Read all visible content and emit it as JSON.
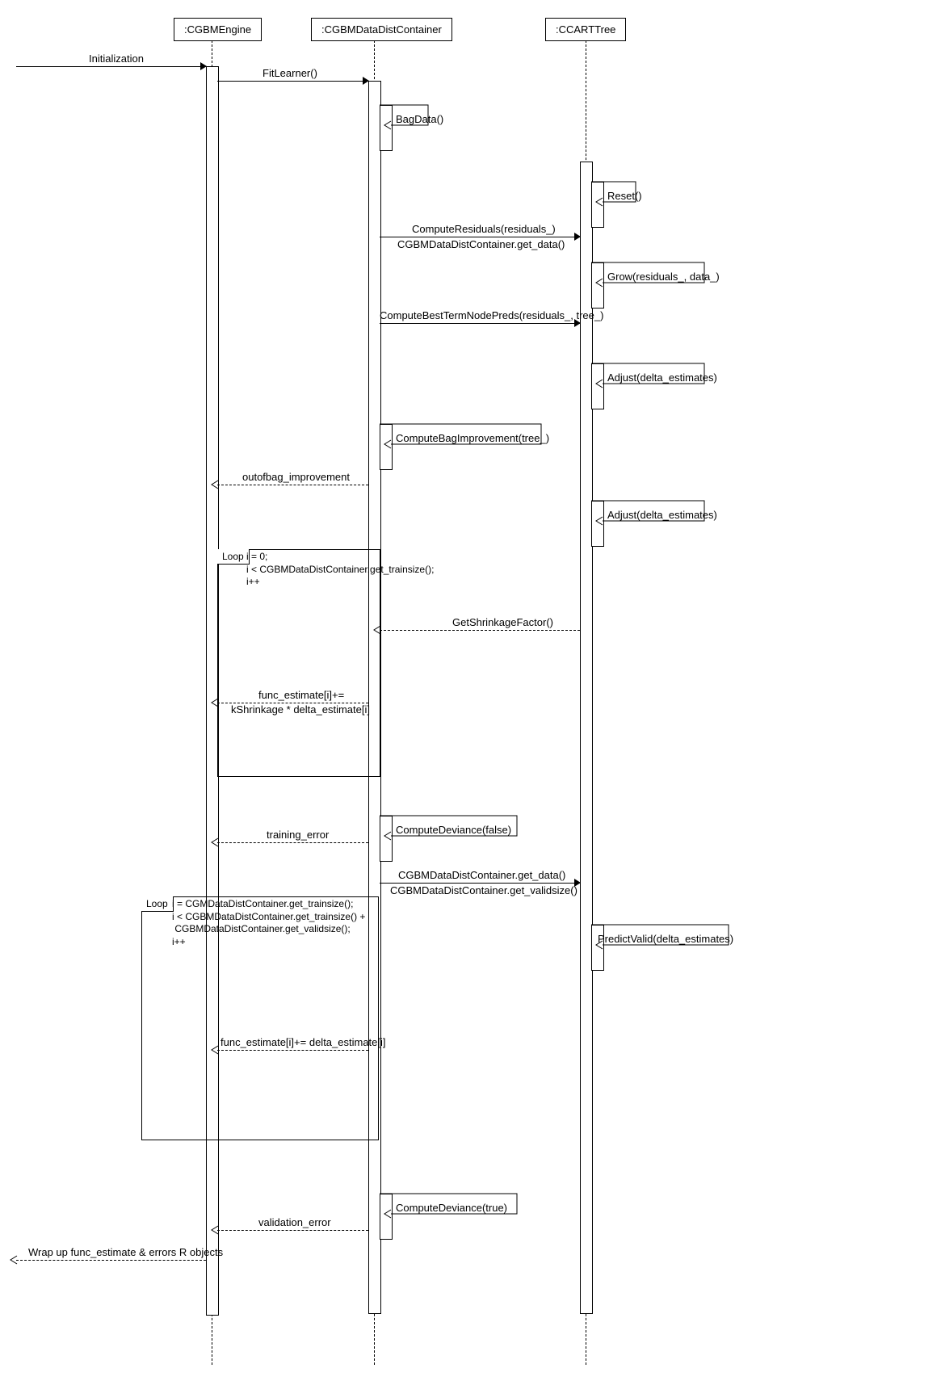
{
  "participants": {
    "engine": ":CGBMEngine",
    "container": ":CGBMDataDistContainer",
    "tree": ":CCARTTree"
  },
  "messages": {
    "init": "Initialization",
    "fitLearner": "FitLearner()",
    "bagData": "BagData()",
    "reset": "Reset()",
    "compRes": "ComputeResiduals(residuals_)",
    "getData1": "CGBMDataDistContainer.get_data()",
    "grow": "Grow(residuals_, data_)",
    "bestTerm": "ComputeBestTermNodePreds(residuals_, tree_)",
    "adjust1": "Adjust(delta_estimates)",
    "bagImp": "ComputeBagImprovement(tree_)",
    "oob": "outofbag_improvement",
    "adjust2": "Adjust(delta_estimates)",
    "getShrink": "GetShrinkageFactor()",
    "funcUp1a": "func_estimate[i]+=",
    "funcUp1b": "kShrinkage * delta_estimate[i]",
    "compDev1": "ComputeDeviance(false)",
    "trainErr": "training_error",
    "getData2": "CGBMDataDistContainer.get_data()",
    "getValid": "CGBMDataDistContainer.get_validsize()",
    "predValid": "PredictValid(delta_estimates)",
    "funcUp2": "func_estimate[i]+= delta_estimate[i]",
    "compDev2": "ComputeDeviance(true)",
    "valErr": "validation_error",
    "wrap": "Wrap up func_estimate & errors R objects"
  },
  "loops": {
    "loop1": {
      "tag": "Loop",
      "cond": "i = 0;\ni < CGBMDataDistContainer.get_trainsize();\ni++"
    },
    "loop2": {
      "tag": "Loop",
      "cond": "i = CGMDataDistContainer.get_trainsize();\ni < CGBMDataDistContainer.get_trainsize() +\n CGBMDataDistContainer.get_validsize();\ni++"
    }
  }
}
